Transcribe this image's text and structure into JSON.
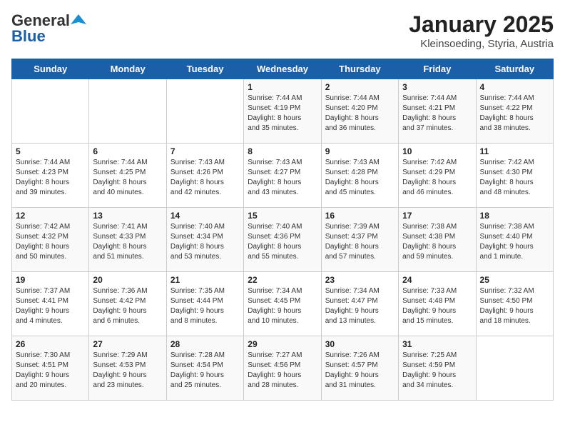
{
  "logo": {
    "general": "General",
    "blue": "Blue"
  },
  "title": "January 2025",
  "subtitle": "Kleinsoeding, Styria, Austria",
  "weekdays": [
    "Sunday",
    "Monday",
    "Tuesday",
    "Wednesday",
    "Thursday",
    "Friday",
    "Saturday"
  ],
  "weeks": [
    [
      {
        "day": "",
        "content": ""
      },
      {
        "day": "",
        "content": ""
      },
      {
        "day": "",
        "content": ""
      },
      {
        "day": "1",
        "content": "Sunrise: 7:44 AM\nSunset: 4:19 PM\nDaylight: 8 hours\nand 35 minutes."
      },
      {
        "day": "2",
        "content": "Sunrise: 7:44 AM\nSunset: 4:20 PM\nDaylight: 8 hours\nand 36 minutes."
      },
      {
        "day": "3",
        "content": "Sunrise: 7:44 AM\nSunset: 4:21 PM\nDaylight: 8 hours\nand 37 minutes."
      },
      {
        "day": "4",
        "content": "Sunrise: 7:44 AM\nSunset: 4:22 PM\nDaylight: 8 hours\nand 38 minutes."
      }
    ],
    [
      {
        "day": "5",
        "content": "Sunrise: 7:44 AM\nSunset: 4:23 PM\nDaylight: 8 hours\nand 39 minutes."
      },
      {
        "day": "6",
        "content": "Sunrise: 7:44 AM\nSunset: 4:25 PM\nDaylight: 8 hours\nand 40 minutes."
      },
      {
        "day": "7",
        "content": "Sunrise: 7:43 AM\nSunset: 4:26 PM\nDaylight: 8 hours\nand 42 minutes."
      },
      {
        "day": "8",
        "content": "Sunrise: 7:43 AM\nSunset: 4:27 PM\nDaylight: 8 hours\nand 43 minutes."
      },
      {
        "day": "9",
        "content": "Sunrise: 7:43 AM\nSunset: 4:28 PM\nDaylight: 8 hours\nand 45 minutes."
      },
      {
        "day": "10",
        "content": "Sunrise: 7:42 AM\nSunset: 4:29 PM\nDaylight: 8 hours\nand 46 minutes."
      },
      {
        "day": "11",
        "content": "Sunrise: 7:42 AM\nSunset: 4:30 PM\nDaylight: 8 hours\nand 48 minutes."
      }
    ],
    [
      {
        "day": "12",
        "content": "Sunrise: 7:42 AM\nSunset: 4:32 PM\nDaylight: 8 hours\nand 50 minutes."
      },
      {
        "day": "13",
        "content": "Sunrise: 7:41 AM\nSunset: 4:33 PM\nDaylight: 8 hours\nand 51 minutes."
      },
      {
        "day": "14",
        "content": "Sunrise: 7:40 AM\nSunset: 4:34 PM\nDaylight: 8 hours\nand 53 minutes."
      },
      {
        "day": "15",
        "content": "Sunrise: 7:40 AM\nSunset: 4:36 PM\nDaylight: 8 hours\nand 55 minutes."
      },
      {
        "day": "16",
        "content": "Sunrise: 7:39 AM\nSunset: 4:37 PM\nDaylight: 8 hours\nand 57 minutes."
      },
      {
        "day": "17",
        "content": "Sunrise: 7:38 AM\nSunset: 4:38 PM\nDaylight: 8 hours\nand 59 minutes."
      },
      {
        "day": "18",
        "content": "Sunrise: 7:38 AM\nSunset: 4:40 PM\nDaylight: 9 hours\nand 1 minute."
      }
    ],
    [
      {
        "day": "19",
        "content": "Sunrise: 7:37 AM\nSunset: 4:41 PM\nDaylight: 9 hours\nand 4 minutes."
      },
      {
        "day": "20",
        "content": "Sunrise: 7:36 AM\nSunset: 4:42 PM\nDaylight: 9 hours\nand 6 minutes."
      },
      {
        "day": "21",
        "content": "Sunrise: 7:35 AM\nSunset: 4:44 PM\nDaylight: 9 hours\nand 8 minutes."
      },
      {
        "day": "22",
        "content": "Sunrise: 7:34 AM\nSunset: 4:45 PM\nDaylight: 9 hours\nand 10 minutes."
      },
      {
        "day": "23",
        "content": "Sunrise: 7:34 AM\nSunset: 4:47 PM\nDaylight: 9 hours\nand 13 minutes."
      },
      {
        "day": "24",
        "content": "Sunrise: 7:33 AM\nSunset: 4:48 PM\nDaylight: 9 hours\nand 15 minutes."
      },
      {
        "day": "25",
        "content": "Sunrise: 7:32 AM\nSunset: 4:50 PM\nDaylight: 9 hours\nand 18 minutes."
      }
    ],
    [
      {
        "day": "26",
        "content": "Sunrise: 7:30 AM\nSunset: 4:51 PM\nDaylight: 9 hours\nand 20 minutes."
      },
      {
        "day": "27",
        "content": "Sunrise: 7:29 AM\nSunset: 4:53 PM\nDaylight: 9 hours\nand 23 minutes."
      },
      {
        "day": "28",
        "content": "Sunrise: 7:28 AM\nSunset: 4:54 PM\nDaylight: 9 hours\nand 25 minutes."
      },
      {
        "day": "29",
        "content": "Sunrise: 7:27 AM\nSunset: 4:56 PM\nDaylight: 9 hours\nand 28 minutes."
      },
      {
        "day": "30",
        "content": "Sunrise: 7:26 AM\nSunset: 4:57 PM\nDaylight: 9 hours\nand 31 minutes."
      },
      {
        "day": "31",
        "content": "Sunrise: 7:25 AM\nSunset: 4:59 PM\nDaylight: 9 hours\nand 34 minutes."
      },
      {
        "day": "",
        "content": ""
      }
    ]
  ]
}
